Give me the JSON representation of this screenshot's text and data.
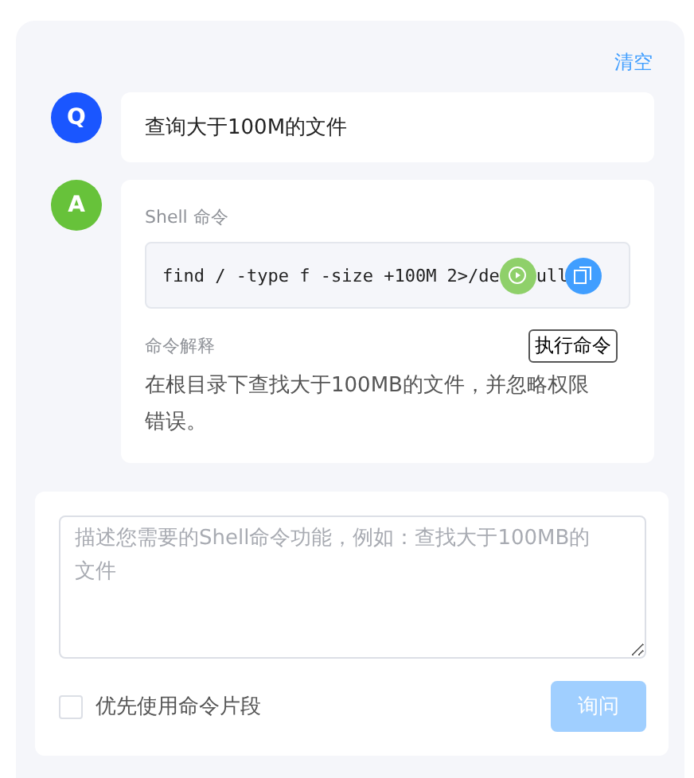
{
  "clear_link": "清空",
  "messages": [
    {
      "kind": "question",
      "avatar": "Q",
      "text": "查询大于100M的文件"
    },
    {
      "kind": "answer",
      "avatar": "A",
      "command_label": "Shell 命令",
      "command": "find / -type f -size +100M 2>/de",
      "command_tail": "ull",
      "tooltip": "执行命令",
      "explanation_label": "命令解释",
      "explanation": "在根目录下查找大于100MB的文件，并忽略权限错误。"
    }
  ],
  "input": {
    "placeholder": "描述您需要的Shell命令功能，例如：查找大于100MB的文件"
  },
  "option": {
    "label": "优先使用命令片段",
    "checked": false
  },
  "submit": {
    "label": "询问",
    "disabled": true
  }
}
